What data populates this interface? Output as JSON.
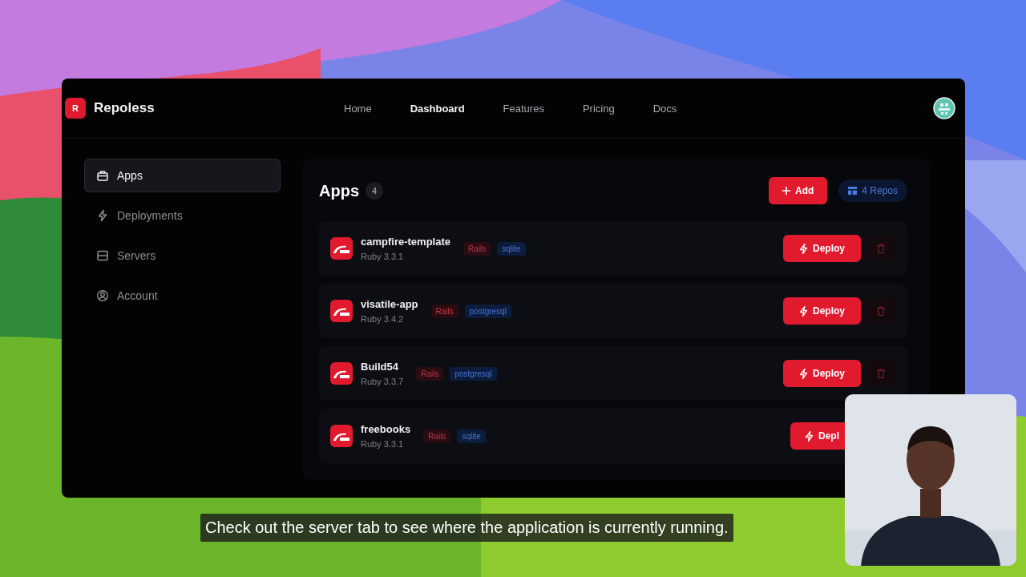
{
  "brand": {
    "logo_letter": "R",
    "name": "Repoless"
  },
  "nav": [
    {
      "label": "Home",
      "selected": false
    },
    {
      "label": "Dashboard",
      "selected": true
    },
    {
      "label": "Features",
      "selected": false
    },
    {
      "label": "Pricing",
      "selected": false
    },
    {
      "label": "Docs",
      "selected": false
    }
  ],
  "sidebar": {
    "items": [
      {
        "label": "Apps",
        "selected": true
      },
      {
        "label": "Deployments",
        "selected": false
      },
      {
        "label": "Servers",
        "selected": false
      },
      {
        "label": "Account",
        "selected": false
      }
    ]
  },
  "apps_panel": {
    "title": "Apps",
    "count": "4",
    "add_button": "Add",
    "repos_badge": "4 Repos",
    "apps": [
      {
        "name": "campfire-template",
        "runtime": "Ruby 3.3.1",
        "tags": [
          {
            "label": "Rails",
            "kind": "framework"
          },
          {
            "label": "sqlite",
            "kind": "database"
          }
        ],
        "deploy_label": "Deploy"
      },
      {
        "name": "visatile-app",
        "runtime": "Ruby 3.4.2",
        "tags": [
          {
            "label": "Rails",
            "kind": "framework"
          },
          {
            "label": "postgresql",
            "kind": "database"
          }
        ],
        "deploy_label": "Deploy"
      },
      {
        "name": "Build54",
        "runtime": "Ruby 3.3.7",
        "tags": [
          {
            "label": "Rails",
            "kind": "framework"
          },
          {
            "label": "postgresql",
            "kind": "database"
          }
        ],
        "deploy_label": "Deploy"
      },
      {
        "name": "freebooks",
        "runtime": "Ruby 3.3.1",
        "tags": [
          {
            "label": "Rails",
            "kind": "framework"
          },
          {
            "label": "sqlite",
            "kind": "database"
          }
        ],
        "deploy_label": "Depl"
      }
    ]
  },
  "caption": "Check out the server tab to see where the application is currently running."
}
